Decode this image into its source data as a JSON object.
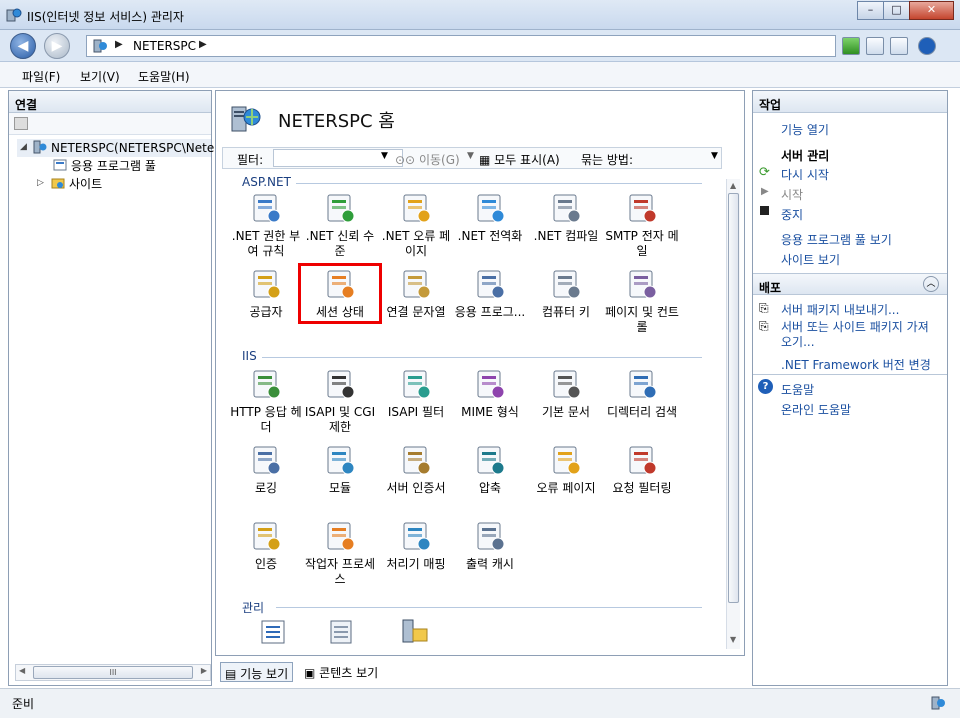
{
  "window": {
    "title": "IIS(인터넷 정보 서비스) 관리자",
    "min": "–",
    "max": "□",
    "close": "✕"
  },
  "address": {
    "path": "NETERSPC",
    "sep": "▶"
  },
  "menu": [
    {
      "label": "파일(F)"
    },
    {
      "label": "보기(V)"
    },
    {
      "label": "도움말(H)"
    }
  ],
  "connections": {
    "header": "연결",
    "server": "NETERSPC(NETERSPC\\Neter",
    "apppools": "응용 프로그램 풀",
    "sites": "사이트"
  },
  "main": {
    "title": "NETERSPC 홈",
    "filter_label": "필터:",
    "go_label": "이동(G)",
    "show_all": "모두 표시(A)",
    "group_by": "묶는 방법:",
    "groups": {
      "aspnet": "ASP.NET",
      "iis": "IIS",
      "management": "관리"
    },
    "features": [
      {
        "label": ".NET 권한 부여 규칙",
        "icon": "lock-users-icon"
      },
      {
        "label": ".NET 신뢰 수준",
        "icon": "globe-check-icon"
      },
      {
        "label": ".NET 오류 페이지",
        "icon": "warning-404-icon"
      },
      {
        "label": ".NET 전역화",
        "icon": "globe-icon"
      },
      {
        "label": ".NET 컴파일",
        "icon": "compile-stack-icon"
      },
      {
        "label": "SMTP 전자 메일",
        "icon": "mail-screen-icon"
      },
      {
        "label": "공급자",
        "icon": "provider-icon"
      },
      {
        "label": "세션 상태",
        "icon": "session-user-icon"
      },
      {
        "label": "연결 문자열",
        "icon": "connection-db-icon"
      },
      {
        "label": "응용 프로그...",
        "icon": "app-settings-icon"
      },
      {
        "label": "컴퓨터 키",
        "icon": "machine-key-icon"
      },
      {
        "label": "페이지 및 컨트롤",
        "icon": "pages-controls-icon"
      },
      {
        "label": "HTTP 응답 헤더",
        "icon": "http-headers-icon"
      },
      {
        "label": "ISAPI 및 CGI 제한",
        "icon": "cgi-icon"
      },
      {
        "label": "ISAPI 필터",
        "icon": "isapi-filter-icon"
      },
      {
        "label": "MIME 형식",
        "icon": "mime-icon"
      },
      {
        "label": "기본 문서",
        "icon": "default-doc-icon"
      },
      {
        "label": "디렉터리 검색",
        "icon": "dir-browse-icon"
      },
      {
        "label": "로깅",
        "icon": "logging-icon"
      },
      {
        "label": "모듈",
        "icon": "modules-icon"
      },
      {
        "label": "서버 인증서",
        "icon": "certificate-icon"
      },
      {
        "label": "압축",
        "icon": "compression-icon"
      },
      {
        "label": "오류 페이지",
        "icon": "error-pages-icon"
      },
      {
        "label": "요청 필터링",
        "icon": "request-filter-icon"
      },
      {
        "label": "인증",
        "icon": "auth-icon"
      },
      {
        "label": "작업자 프로세스",
        "icon": "worker-process-icon"
      },
      {
        "label": "처리기 매핑",
        "icon": "handler-mapping-icon"
      },
      {
        "label": "출력 캐시",
        "icon": "output-cache-icon"
      }
    ],
    "tabs": {
      "features": "기능 보기",
      "content": "콘텐츠 보기"
    }
  },
  "actions": {
    "header": "작업",
    "open_feature": "기능 열기",
    "server_manage": "서버 관리",
    "restart": "다시 시작",
    "start": "시작",
    "stop": "중지",
    "view_apppools": "응용 프로그램 풀 보기",
    "view_sites": "사이트 보기",
    "deploy_header": "배포",
    "export_pkg": "서버 패키지 내보내기...",
    "install_pkg_1": "서버 또는 사이트 패키지 가져",
    "install_pkg_2": "오기...",
    "netfx": ".NET Framework 버전 변경",
    "help": "도움말",
    "online_help": "온라인 도움말"
  },
  "status": {
    "text": "준비"
  },
  "colors": {
    "selection_border": "#e00000",
    "link": "#1a4fa0",
    "group_header": "#1b3f80"
  }
}
